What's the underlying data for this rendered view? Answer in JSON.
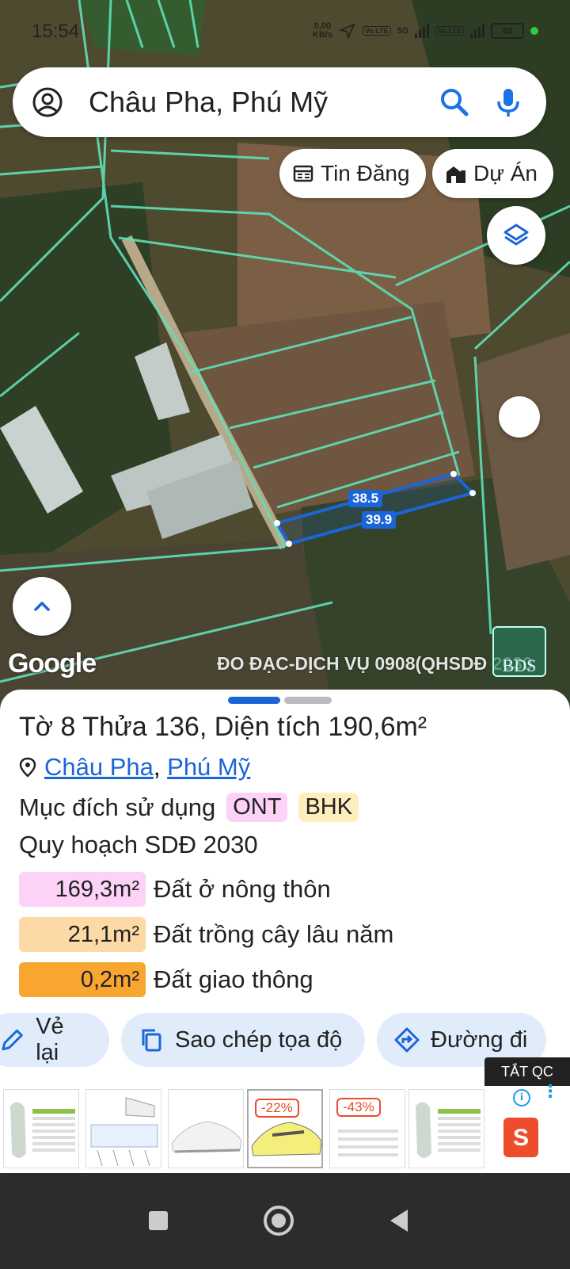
{
  "status_bar": {
    "time": "15:54",
    "net_speed": "0,00",
    "net_unit": "KB/s",
    "lte1": "Vo LTE",
    "net_type": "5G",
    "lte2": "Vo LTE",
    "battery": "49"
  },
  "search": {
    "query": "Châu Pha, Phú Mỹ"
  },
  "chips": {
    "listings": "Tin Đăng",
    "projects": "Dự Án"
  },
  "map": {
    "measure_top": "38.5",
    "measure_bottom": "39.9",
    "google_logo": "Google",
    "watermark": "ĐO ĐẠC-DỊCH VỤ 0908(QHSDĐ 2030",
    "watermark_logo": "BDS",
    "parcel_color": "#1a66d9",
    "boundary_color": "#5fe0b8"
  },
  "parcel": {
    "title_prefix": "Tờ",
    "sheet_no": "8",
    "plot_label": "Thửa",
    "plot_no": "136",
    "area_label": "Diện tích",
    "area": "190,6m²",
    "location": {
      "commune": "Châu Pha",
      "separator": ",",
      "district": "Phú Mỹ"
    },
    "purpose_label": "Mục đích sử dụng",
    "purpose_tags": [
      {
        "code": "ONT",
        "color": "#fcd2f7"
      },
      {
        "code": "BHK",
        "color": "#fdeebd"
      }
    ],
    "plan_label": "Quy hoạch SDĐ 2030",
    "plan_areas": [
      {
        "area": "169,3m²",
        "label": "Đất ở nông thôn",
        "color": "#fcd2f7"
      },
      {
        "area": "21,1m²",
        "label": "Đất trồng cây lâu năm",
        "color": "#fdd9a6"
      },
      {
        "area": "0,2m²",
        "label": "Đất giao thông",
        "color": "#f9a630"
      }
    ]
  },
  "actions": {
    "redraw": "Vẻ lại",
    "copy_coords": "Sao chép tọa độ",
    "directions": "Đường đi"
  },
  "ad": {
    "close_label": "TẮT QC",
    "discount1": "-22%",
    "discount2": "-43%",
    "brand_letter": "S",
    "info": "i"
  }
}
